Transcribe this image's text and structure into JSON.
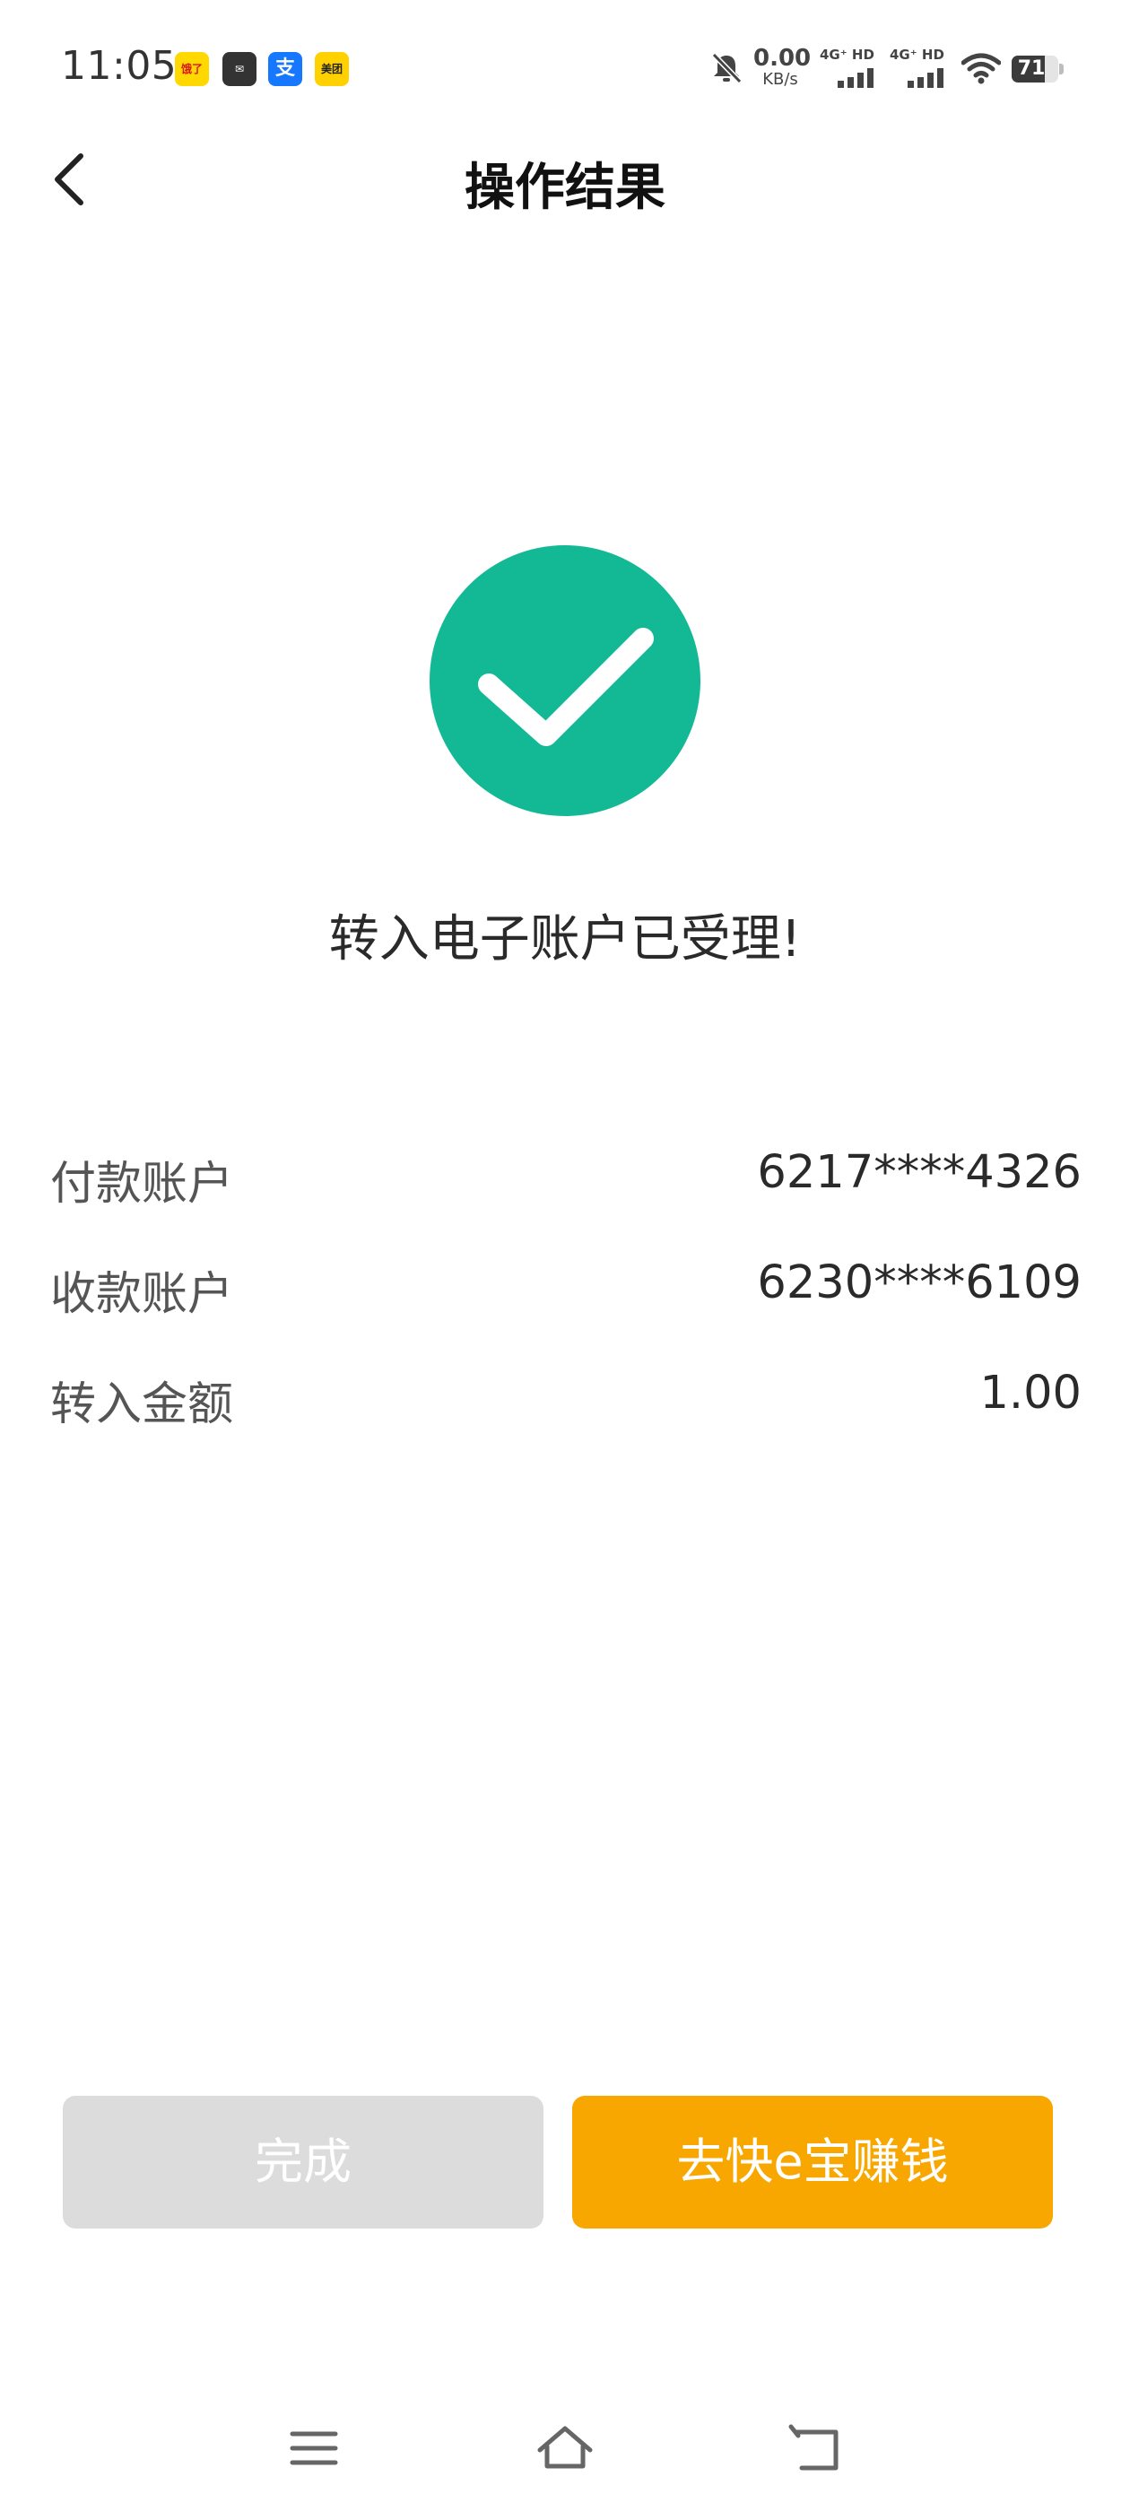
{
  "status_bar": {
    "time": "11:05",
    "apps": [
      {
        "name": "eleme",
        "label": "饿了"
      },
      {
        "name": "mail",
        "label": "✉"
      },
      {
        "name": "alipay",
        "label": "支"
      },
      {
        "name": "meituan",
        "label": "美团"
      }
    ],
    "net_speed_value": "0.00",
    "net_speed_unit": "KB/s",
    "network_1": "4G⁺ HD",
    "network_2": "4G⁺ HD",
    "battery_level": "71"
  },
  "header": {
    "title": "操作结果"
  },
  "result": {
    "message": "转入电子账户已受理!"
  },
  "details": [
    {
      "label": "付款账户",
      "value": "6217****4326"
    },
    {
      "label": "收款账户",
      "value": "6230****6109"
    },
    {
      "label": "转入金额",
      "value": "1.00"
    }
  ],
  "buttons": {
    "done_label": "完成",
    "primary_label": "去快e宝赚钱"
  },
  "colors": {
    "success": "#13b894",
    "primary": "#f8a700",
    "disabled": "#dcdcdc"
  }
}
